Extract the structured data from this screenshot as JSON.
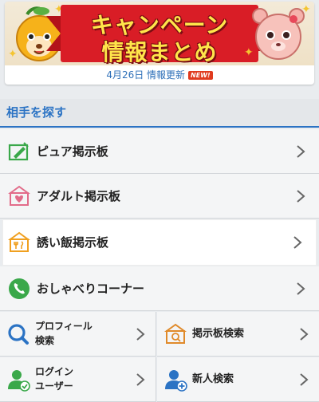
{
  "banner": {
    "title_line1": "キャンペーン",
    "title_line2": "情報まとめ",
    "update_text": "4月26日 情報更新",
    "new_badge": "NEW!"
  },
  "section": {
    "title": "相手を探す"
  },
  "menu": [
    {
      "label": "ピュア掲示板",
      "icon": "pure-board-icon"
    },
    {
      "label": "アダルト掲示板",
      "icon": "adult-board-icon"
    },
    {
      "label": "誘い飯掲示板",
      "icon": "meal-board-icon"
    },
    {
      "label": "おしゃべりコーナー",
      "icon": "phone-icon"
    }
  ],
  "grid": [
    {
      "line1": "プロフィール",
      "line2": "検索",
      "icon": "search-icon"
    },
    {
      "line1": "掲示板検索",
      "icon": "board-search-icon"
    },
    {
      "line1": "ログイン",
      "line2": "ユーザー",
      "icon": "login-user-icon"
    },
    {
      "line1": "新人検索",
      "icon": "new-user-icon"
    }
  ],
  "colors": {
    "accent": "#2b73c4",
    "green": "#3aa84a",
    "pink": "#e26c8a",
    "orange": "#f0a020"
  }
}
